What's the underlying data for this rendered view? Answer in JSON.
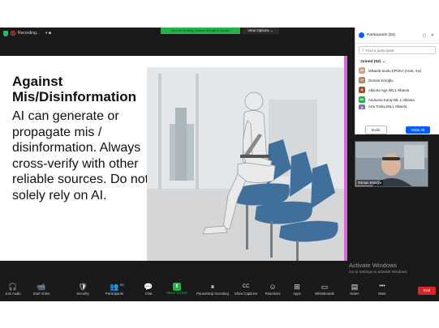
{
  "topbar": {
    "recording_label": "Recording...",
    "recording_controls": "⏸ ■",
    "share_banner": "You are viewing Osman Köroğlu's screen",
    "view_options_label": "View Options"
  },
  "slide": {
    "title": "Against Mis/Disinformation",
    "body": "AI can generate or propagate mis / disinformation. Always cross-verify with other reliable sources. Do not solely rely on AI."
  },
  "participants_panel": {
    "title": "Participants (53)",
    "window_controls": "▢ ✕",
    "search_placeholder": "Find a participant",
    "joined_label": "Joined (53)",
    "participants": [
      {
        "name": "Mikaela Suolu EPOKA (Host, me)",
        "initials": "M",
        "color": "#c9a38a"
      },
      {
        "name": "Osman Köroğlu",
        "initials": "O",
        "color": "#b08a6f"
      },
      {
        "name": "Albjona Aga IML1 Albania",
        "initials": "A",
        "color": "#a0522d"
      },
      {
        "name": "Anduena Karaj IML 1 Albania",
        "initials": "AK",
        "color": "#23b24a"
      },
      {
        "name": "Arta Toska IML1 Albania",
        "initials": "A",
        "color": "#8a6fb0"
      }
    ],
    "invite_label": "Invite",
    "mute_all_label": "Mute All"
  },
  "video": {
    "name": "Osman Köroğlu"
  },
  "watermark": {
    "line1": "Activate Windows",
    "line2": "Go to Settings to activate Windows."
  },
  "toolbar": {
    "items": [
      {
        "icon": "🎧",
        "label": "Join Audio"
      },
      {
        "icon": "📹",
        "label": "Start Video"
      },
      {
        "icon": "🛡",
        "label": "Security"
      },
      {
        "icon": "👥",
        "label": "Participants"
      },
      {
        "icon": "💬",
        "label": "Chat"
      },
      {
        "icon": "⬆",
        "label": "Share Screen"
      },
      {
        "icon": "⏸",
        "label": "Pause/stop recording"
      },
      {
        "icon": "CC",
        "label": "Show Captions"
      },
      {
        "icon": "☺",
        "label": "Reactions"
      },
      {
        "icon": "⊞",
        "label": "Apps"
      },
      {
        "icon": "▭",
        "label": "Whiteboards"
      },
      {
        "icon": "▤",
        "label": "Notes"
      },
      {
        "icon": "•••",
        "label": "More"
      }
    ],
    "participant_count": "53",
    "end_label": "End"
  }
}
